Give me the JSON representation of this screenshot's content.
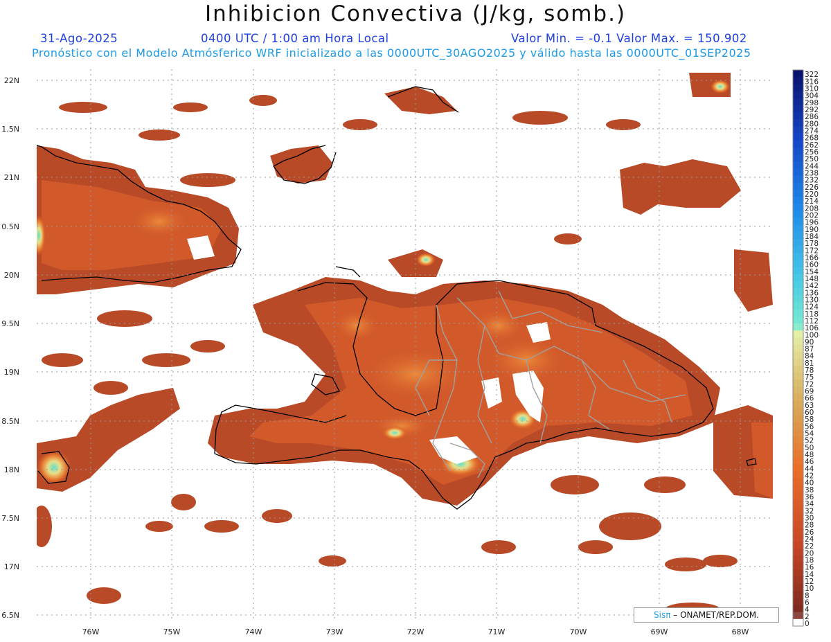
{
  "header": {
    "title": "Inhibicion Convectiva (J/kg, somb.)",
    "date": "31-Ago-2025",
    "time": "0400 UTC / 1:00 am Hora Local",
    "minmax": "Valor Min. = -0.1  Valor Max. = 150.902",
    "model": "Pronóstico con el Modelo Atmósferico WRF inicializado a las 0000UTC_30AGO2025 y válido hasta las  0000UTC_01SEP2025"
  },
  "map": {
    "lat_labels": [
      "22N",
      "1.5N",
      "21N",
      "0.5N",
      "20N",
      "9.5N",
      "19N",
      "8.5N",
      "18N",
      "7.5N",
      "17N",
      "6.5N"
    ],
    "lon_labels": [
      "76W",
      "75W",
      "74W",
      "73W",
      "72W",
      "71W",
      "70W",
      "69W",
      "68W"
    ],
    "colors": {
      "land_fill": "#a9472a",
      "field_base": "#b84a28",
      "field_mid": "#d2592a",
      "field_hi": "#e8792f",
      "field_peak": "#63e0cc",
      "coast": "#000000",
      "border": "#a0a0a0",
      "grid": "#9a9a9a"
    }
  },
  "colorbar": {
    "labels": [
      "322",
      "316",
      "310",
      "304",
      "298",
      "292",
      "286",
      "280",
      "274",
      "268",
      "262",
      "256",
      "250",
      "244",
      "238",
      "232",
      "226",
      "220",
      "214",
      "208",
      "202",
      "196",
      "190",
      "184",
      "178",
      "172",
      "166",
      "160",
      "154",
      "148",
      "142",
      "136",
      "130",
      "124",
      "118",
      "112",
      "106",
      "100",
      "90",
      "87",
      "84",
      "81",
      "78",
      "75",
      "72",
      "69",
      "66",
      "63",
      "60",
      "58",
      "56",
      "54",
      "52",
      "50",
      "48",
      "46",
      "44",
      "42",
      "40",
      "38",
      "36",
      "34",
      "32",
      "30",
      "28",
      "26",
      "24",
      "22",
      "20",
      "18",
      "16",
      "14",
      "12",
      "10",
      "8",
      "6",
      "4",
      "2",
      "0"
    ]
  },
  "credit": {
    "logo": "Sisπ",
    "text": "– ONAMET/REP.DOM."
  }
}
